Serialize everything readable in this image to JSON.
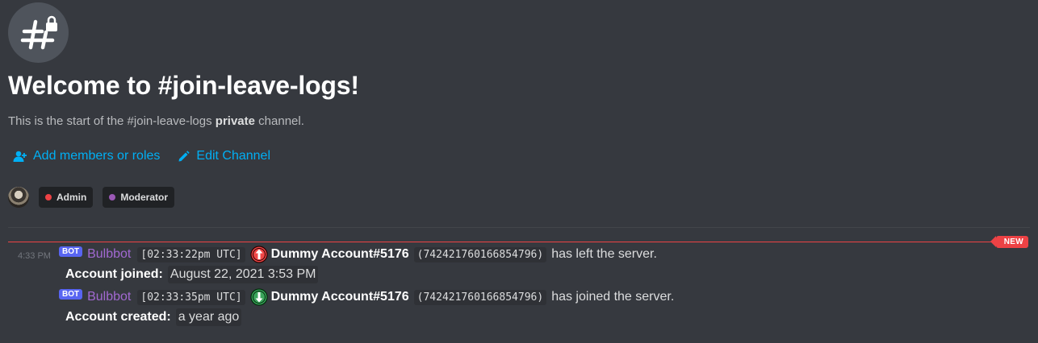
{
  "header": {
    "title": "Welcome to #join-leave-logs!",
    "subtitle_prefix": "This is the start of the #join-leave-logs ",
    "subtitle_bold": "private",
    "subtitle_suffix": " channel.",
    "channel_icon": "locked-hashtag-icon"
  },
  "actions": {
    "add_members": {
      "label": "Add members or roles",
      "icon": "add-person-icon"
    },
    "edit_channel": {
      "label": "Edit Channel",
      "icon": "pencil-icon"
    }
  },
  "roles": [
    {
      "name": "Admin",
      "color": "#ed4245"
    },
    {
      "name": "Moderator",
      "color": "#9b59b6"
    }
  ],
  "new_marker": "NEW",
  "messages": [
    {
      "timestamp": "4:33 PM",
      "bot_tag": "BOT",
      "author": "Bulbbot",
      "time_code": "[02:33:22pm UTC]",
      "icon": "arrow-up-red-icon",
      "account": "Dummy Account#5176",
      "user_id": "(742421760166854796)",
      "action": "has left the server.",
      "field_label": "Account joined:",
      "field_value": "August 22, 2021 3:53 PM"
    },
    {
      "bot_tag": "BOT",
      "author": "Bulbbot",
      "time_code": "[02:33:35pm UTC]",
      "icon": "arrow-down-green-icon",
      "account": "Dummy Account#5176",
      "user_id": "(742421760166854796)",
      "action": "has joined the server.",
      "field_label": "Account created:",
      "field_value": "a year ago"
    }
  ],
  "colors": {
    "background": "#36393f",
    "link": "#00aff4",
    "new_red": "#ed4245",
    "bot_blurple": "#5865f2",
    "author_purple": "#a269d2"
  }
}
